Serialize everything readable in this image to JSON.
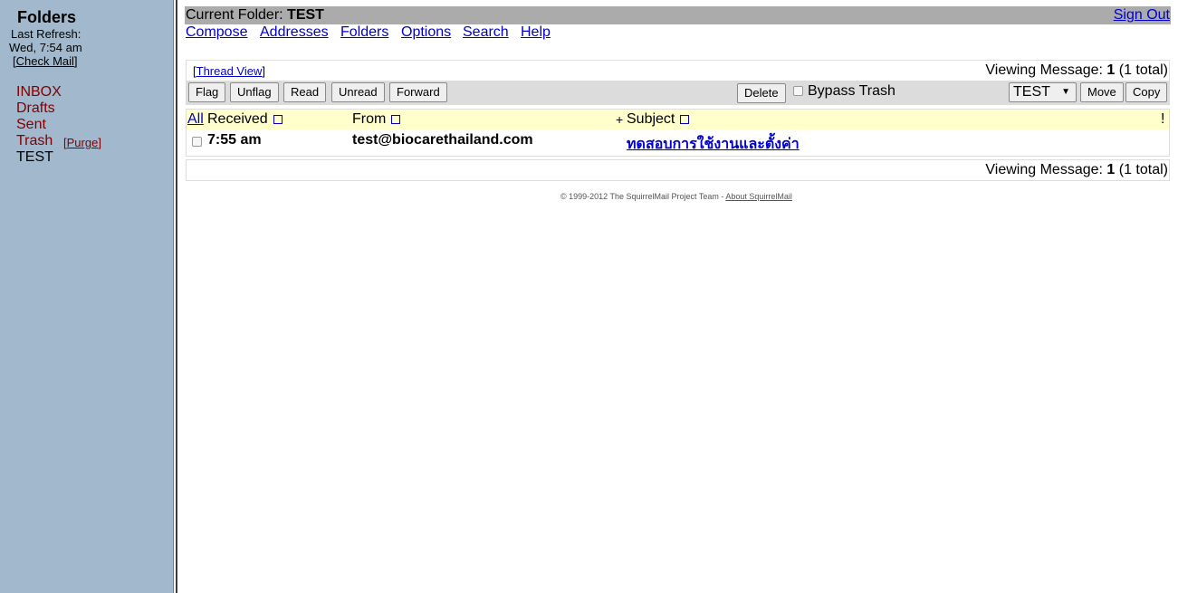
{
  "sidebar": {
    "title": "Folders",
    "last_refresh_label": "Last Refresh:",
    "last_refresh_date": "Wed, 7:54 am",
    "check_mail": "Check Mail",
    "folders": [
      {
        "label": "INBOX"
      },
      {
        "label": "Drafts"
      },
      {
        "label": "Sent"
      },
      {
        "label": "Trash"
      },
      {
        "label": "TEST"
      }
    ],
    "purge_label": "Purge"
  },
  "header": {
    "current_folder_label": "Current Folder: ",
    "current_folder": "TEST",
    "sign_out": "Sign Out"
  },
  "nav": [
    "Compose",
    "Addresses",
    "Folders",
    "Options",
    "Search",
    "Help"
  ],
  "pager": {
    "thread_view": "Thread View",
    "viewing_label": "Viewing Message: ",
    "viewing_num": "1",
    "viewing_total": " (1 total)"
  },
  "toolbar": {
    "flag": "Flag",
    "unflag": "Unflag",
    "read": "Read",
    "unread": "Unread",
    "forward": "Forward",
    "delete": "Delete",
    "bypass_trash": "Bypass Trash",
    "target_folder": "TEST",
    "move": "Move",
    "copy": "Copy"
  },
  "list_header": {
    "all": "All",
    "received": "Received",
    "from": "From",
    "plus": "+",
    "subject": "Subject",
    "priority": "!"
  },
  "messages": [
    {
      "received": "7:55 am",
      "from": "test@biocarethailand.com",
      "subject": "ทดสอบการใช้งานและตั้งค่า"
    }
  ],
  "footer": {
    "copyright": "© 1999-2012 The SquirrelMail Project Team - ",
    "about": "About SquirrelMail"
  },
  "colors": {
    "sidebar_bg": "#a2b9cd",
    "folder_link": "#800000",
    "header_bar": "#ababab",
    "list_header_bg": "#ffffcc",
    "toolbar_bg": "#dcdcdc",
    "link": "#0000cc"
  }
}
